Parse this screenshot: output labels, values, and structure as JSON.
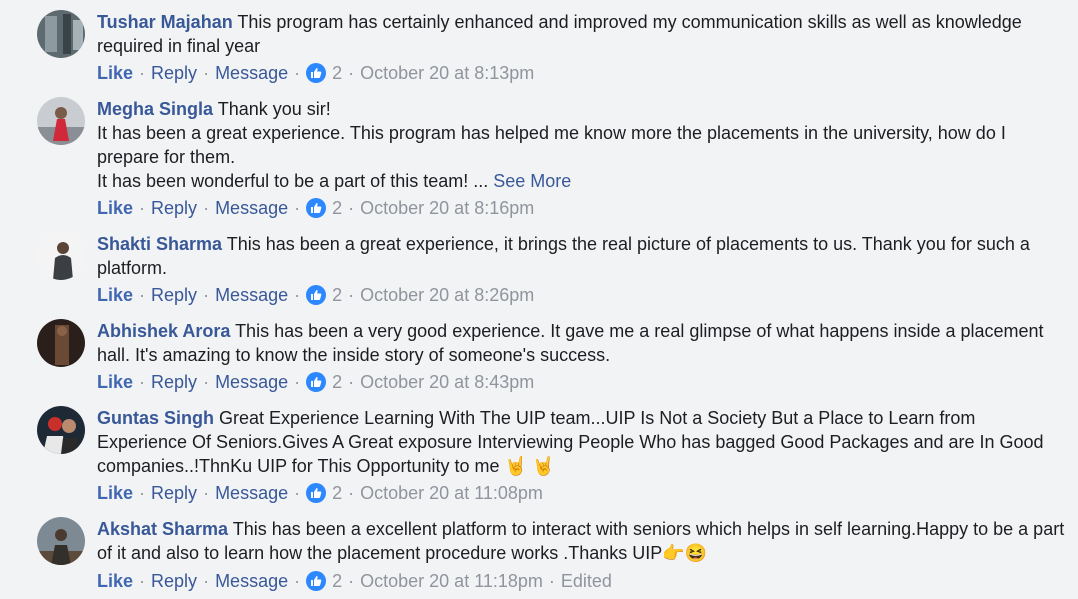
{
  "actions": {
    "like_label": "Like",
    "reply_label": "Reply",
    "message_label": "Message",
    "separator": "·"
  },
  "colors": {
    "author": "#385898",
    "like_blue": "#4267b2",
    "meta_gray": "#90949c",
    "background": "#f2f3f5"
  },
  "comments": [
    {
      "author": "Tushar Majahan",
      "text_lines": [
        "This program has certainly enhanced and improved my communication skills as well as knowledge required in final year"
      ],
      "reaction_count": "2",
      "timestamp": "October 20 at 8:13pm"
    },
    {
      "author": "Megha Singla",
      "text_lines": [
        "Thank you sir!",
        "It has been a great experience. This program has helped me know more the placements in the university, how do I prepare for them.",
        "It has been wonderful to be a part of this team! ..."
      ],
      "see_more": "See More",
      "reaction_count": "2",
      "timestamp": "October 20 at 8:16pm"
    },
    {
      "author": "Shakti Sharma",
      "text_lines": [
        "This has been a great experience, it brings the real picture of placements to us. Thank you for such a platform."
      ],
      "reaction_count": "2",
      "timestamp": "October 20 at 8:26pm"
    },
    {
      "author": "Abhishek Arora",
      "text_lines": [
        "This has been a very good experience. It gave me a real glimpse of what happens inside a placement hall. It's amazing to know the inside story of someone's success."
      ],
      "reaction_count": "2",
      "timestamp": "October 20 at 8:43pm"
    },
    {
      "author": "Guntas Singh",
      "text_lines": [
        "Great Experience Learning With The UIP team...UIP Is Not a Society But a Place to Learn from Experience Of Seniors.Gives A Great exposure Interviewing People Who has bagged Good Packages and are In Good companies..!ThnKu UIP for This Opportunity to me"
      ],
      "emoji": "🤘 🤘",
      "reaction_count": "2",
      "timestamp": "October 20 at 11:08pm"
    },
    {
      "author": "Akshat Sharma",
      "text_lines": [
        "This has been a excellent platform to interact with seniors which helps in self learning.Happy to be a part of it and also to learn how the placement procedure works .Thanks UIP"
      ],
      "emoji": "👉😆",
      "reaction_count": "2",
      "timestamp": "October 20 at 11:18pm",
      "edited_label": "Edited"
    }
  ]
}
